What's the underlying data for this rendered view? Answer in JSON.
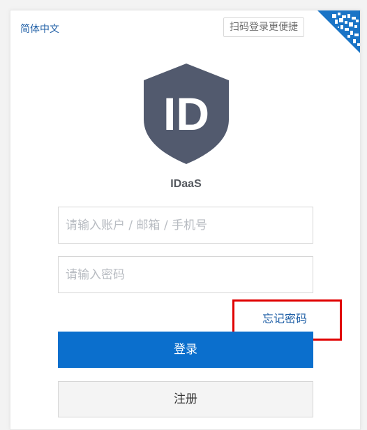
{
  "header": {
    "language_label": "简体中文",
    "qr_tip": "扫码登录更便捷"
  },
  "app": {
    "logo_text": "ID",
    "name": "IDaaS"
  },
  "form": {
    "account_placeholder": "请输入账户 / 邮箱 / 手机号",
    "account_value": "",
    "password_placeholder": "请输入密码",
    "password_value": "",
    "forgot_label": "忘记密码",
    "login_label": "登录",
    "register_label": "注册"
  },
  "colors": {
    "primary": "#0b6fcd",
    "link": "#1f5fa6",
    "logo_shield": "#525a6e",
    "highlight": "#e00000"
  },
  "icons": {
    "qr_corner": "qr-code-icon",
    "logo": "id-shield-logo"
  }
}
